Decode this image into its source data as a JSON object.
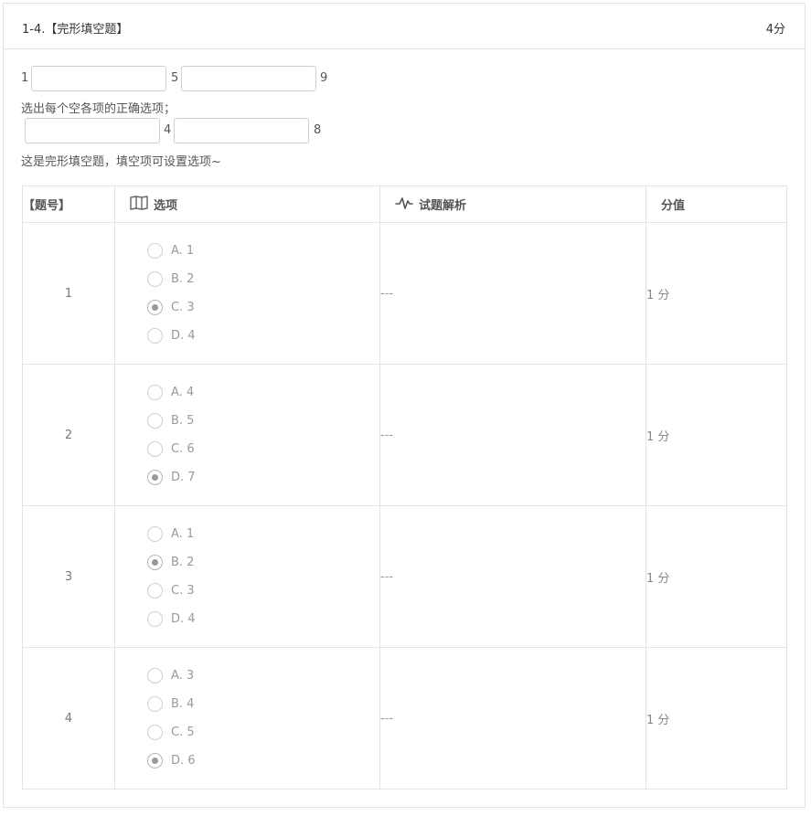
{
  "header": {
    "title": "1-4.【完形填空题】",
    "score": "4分"
  },
  "blanks_row1": {
    "n1": "1",
    "n2": "5",
    "n3": "9"
  },
  "instruction": "选出每个空各项的正确选项；",
  "blanks_row2": {
    "n1": "4",
    "n2": "8"
  },
  "note": "这是完形填空题，填空项可设置选项~",
  "table": {
    "col_number": "【题号】",
    "col_options": "选项",
    "col_analysis": "试题解析",
    "col_score": "分值",
    "rows": [
      {
        "number": "1",
        "options": [
          "A. 1",
          "B. 2",
          "C. 3",
          "D. 4"
        ],
        "selected": 2,
        "analysis": "---",
        "score": "1 分"
      },
      {
        "number": "2",
        "options": [
          "A. 4",
          "B. 5",
          "C. 6",
          "D. 7"
        ],
        "selected": 3,
        "analysis": "---",
        "score": "1 分"
      },
      {
        "number": "3",
        "options": [
          "A. 1",
          "B. 2",
          "C. 3",
          "D. 4"
        ],
        "selected": 1,
        "analysis": "---",
        "score": "1 分"
      },
      {
        "number": "4",
        "options": [
          "A. 3",
          "B. 4",
          "C. 5",
          "D. 6"
        ],
        "selected": 3,
        "analysis": "---",
        "score": "1 分"
      }
    ]
  },
  "icons": {
    "options_icon": "book-icon",
    "analysis_icon": "pulse-icon"
  }
}
